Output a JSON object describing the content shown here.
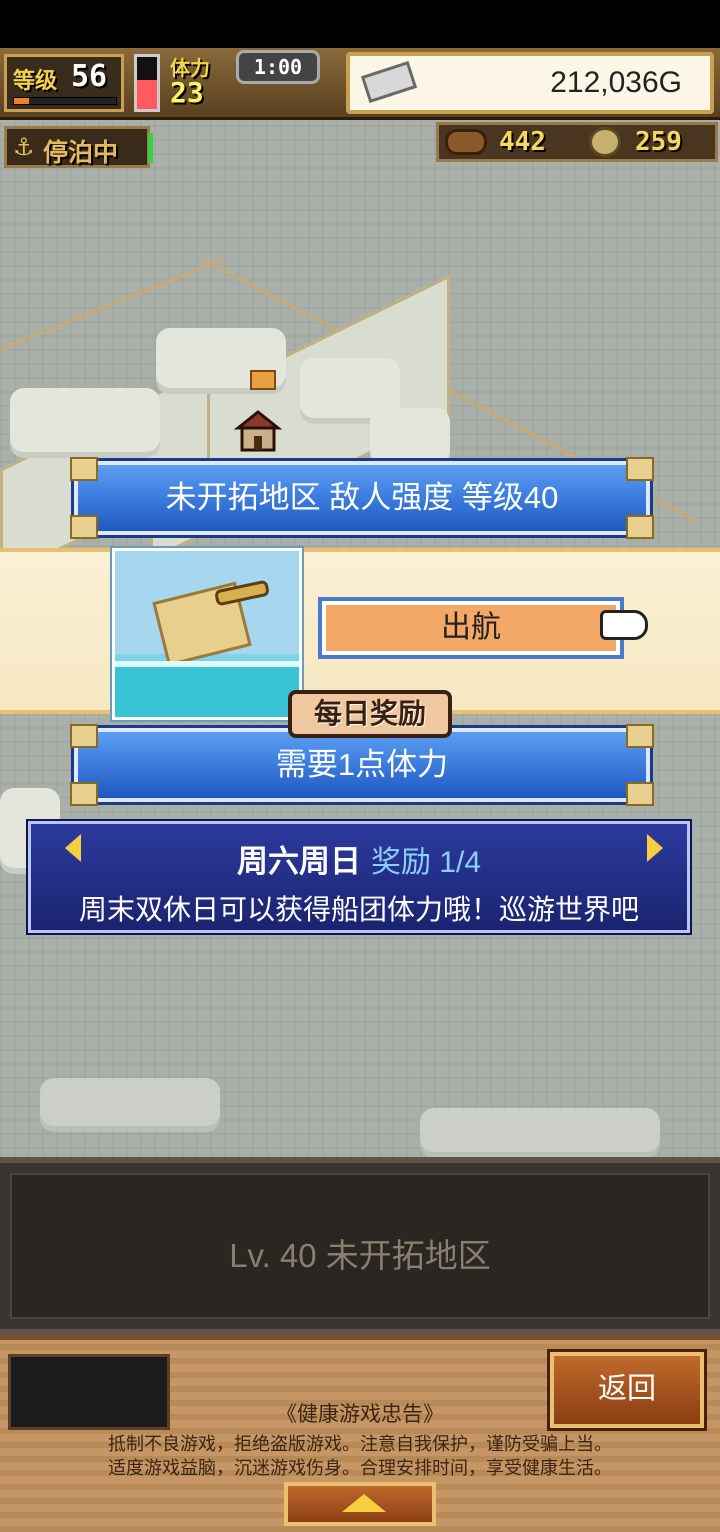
{
  "hud": {
    "level_label": "等级",
    "level_value": "56",
    "exp_progress": 0.15,
    "stamina_label": "体力",
    "stamina_value": "23",
    "stamina_fill": 0.55,
    "timer": "1:00",
    "gold": "212,036G"
  },
  "status": {
    "dock_icon": "anchor-icon",
    "dock_label": "停泊中",
    "wood_value": "442",
    "ore_value": "259"
  },
  "dialog": {
    "title": "未开拓地区  敌人强度 等级40",
    "image_name": "spyglass-treasure-map-image",
    "sail_button": "出航",
    "daily_badge": "每日奖励",
    "cost_text": "需要1点体力"
  },
  "tips": {
    "title": "周六周日",
    "page_label": "奖励 1/4",
    "body": "周末双休日可以获得船团体力哦！巡游世界吧"
  },
  "info_panel": {
    "area_title": "Lv. 40 未开拓地区"
  },
  "footer": {
    "back_button": "返回",
    "notice_title": "《健康游戏忠告》",
    "notice_line1": "抵制不良游戏，拒绝盗版游戏。注意自我保护，谨防受骗上当。",
    "notice_line2": "适度游戏益脑，沉迷游戏伤身。合理安排时间，享受健康生活。"
  },
  "colors": {
    "banner_blue": "#3f7fe0",
    "sail_button": "#f3a868",
    "gold_text": "#f6d860",
    "tips_bg": "#2c3a9e"
  }
}
